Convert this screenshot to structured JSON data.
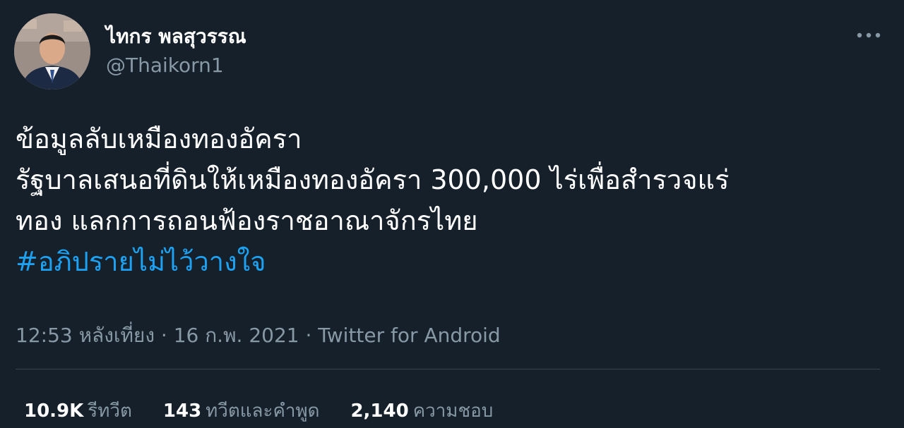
{
  "author": {
    "display_name": "ไทกร พลสุวรรณ",
    "handle": "@Thaikorn1"
  },
  "tweet": {
    "lines": [
      "ข้อมูลลับเหมืองทองอัครา",
      "รัฐบาลเสนอที่ดินให้เหมืองทองอัครา 300,000 ไร่เพื่อสำรวจแร่",
      "ทอง แลกการถอนฟ้องราชอาณาจักรไทย"
    ],
    "hashtag": "#อภิปรายไม่ไว้วางใจ"
  },
  "meta": {
    "time": "12:53 หลังเที่ยง",
    "separator1": " · ",
    "date": "16 ก.พ. 2021",
    "separator2": " · ",
    "source": "Twitter for Android"
  },
  "stats": {
    "retweets_count": "10.9K",
    "retweets_label": "รีทวีต",
    "quotes_count": "143",
    "quotes_label": "ทวีตและคำพูด",
    "likes_count": "2,140",
    "likes_label": "ความชอบ"
  },
  "icons": {
    "more": "more-horizontal-icon"
  },
  "colors": {
    "background": "#15202b",
    "text": "#ffffff",
    "secondary": "#8899a6",
    "link": "#1da1f2",
    "divider": "#38444d"
  }
}
